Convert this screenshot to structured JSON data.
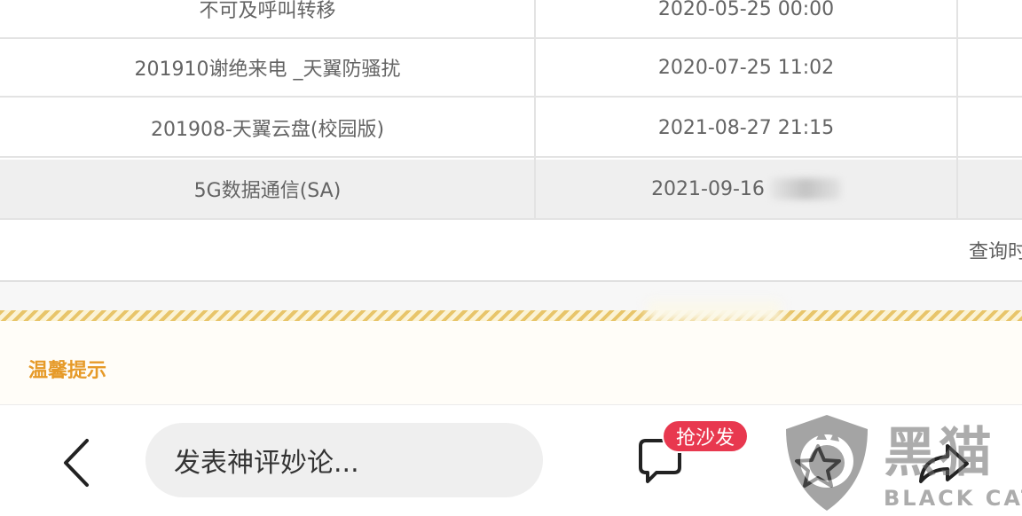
{
  "table": {
    "rows": [
      {
        "name": "不可及呼叫转移",
        "time": "2020-05-25 00:00"
      },
      {
        "name": "201910谢绝来电 _天翼防骚扰",
        "time": "2020-07-25 11:02"
      },
      {
        "name": "201908-天翼云盘(校园版)",
        "time": "2021-08-27 21:15"
      },
      {
        "name": "5G数据通信(SA)",
        "time": "2021-09-16 "
      }
    ],
    "query_label": "查询时"
  },
  "tips": {
    "title": "温馨提示"
  },
  "bottom_bar": {
    "comment_placeholder": "发表神评妙论...",
    "sofa_badge": "抢沙发"
  },
  "watermark": {
    "chars": "黑猫",
    "text": "BLACK CAT"
  },
  "colors": {
    "tip_title": "#e69a28",
    "badge": "#e8384f",
    "highlight_row": "#efefef",
    "stripe": "#e8c56a"
  }
}
